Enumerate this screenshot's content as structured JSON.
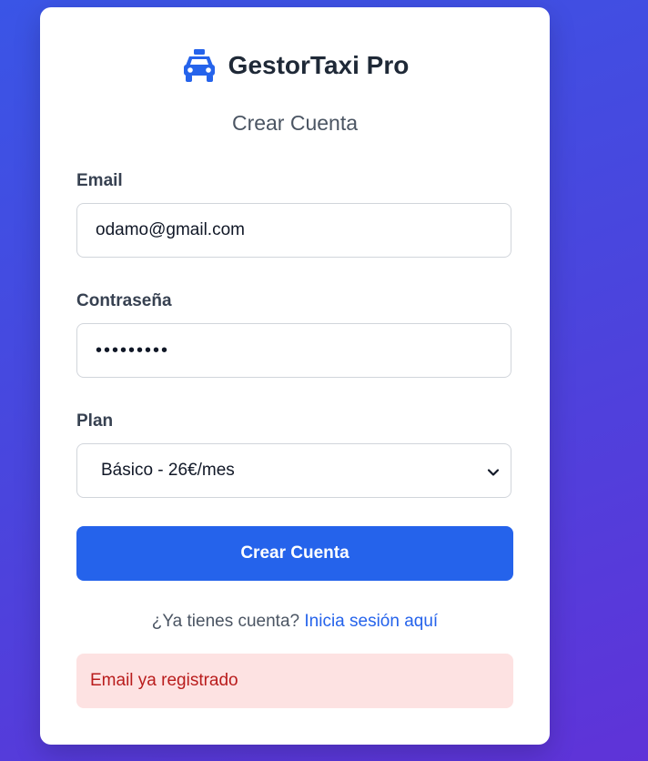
{
  "brand": {
    "title": "GestorTaxi Pro",
    "icon": "taxi-icon",
    "icon_color": "#2563eb"
  },
  "form": {
    "heading": "Crear Cuenta",
    "email_label": "Email",
    "email_value": "odamo@gmail.com",
    "password_label": "Contraseña",
    "password_value": "•••••••••",
    "plan_label": "Plan",
    "plan_selected": "Básico - 26€/mes",
    "submit_label": "Crear Cuenta"
  },
  "login": {
    "prompt": "¿Ya tienes cuenta?",
    "link_text": "Inicia sesión aquí"
  },
  "alert": {
    "message": "Email ya registrado"
  },
  "colors": {
    "accent": "#2563eb",
    "error_bg": "#fde2e2",
    "error_text": "#b91c1c"
  }
}
